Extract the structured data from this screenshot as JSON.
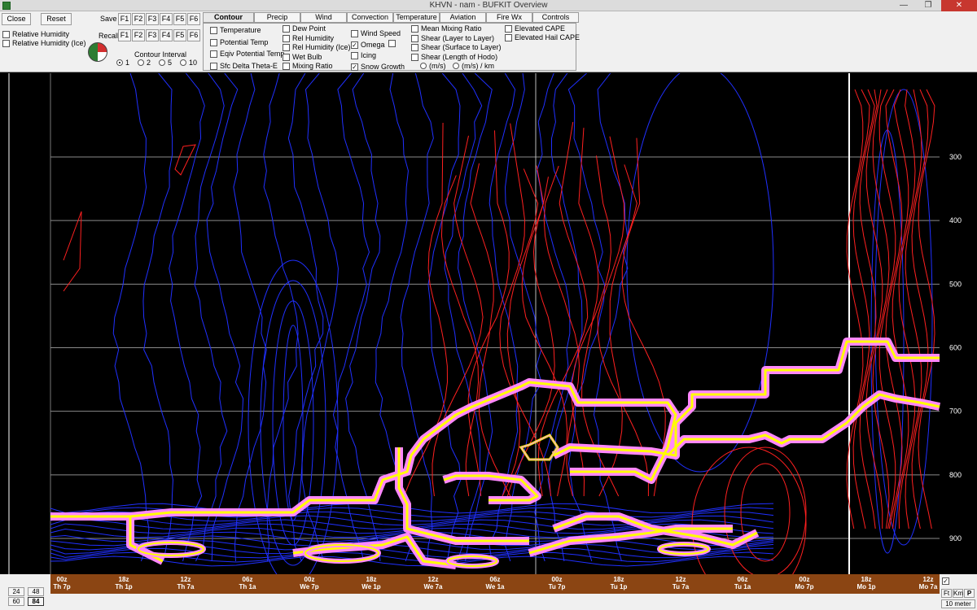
{
  "window": {
    "title": "KHVN - nam - BUFKIT Overview",
    "minimize": "—",
    "maximize": "❐",
    "close": "✕"
  },
  "toolbar": {
    "close_label": "Close",
    "reset_label": "Reset",
    "save_label": "Save",
    "recall_label": "Recall",
    "fkeys": [
      "F1",
      "F2",
      "F3",
      "F4",
      "F5",
      "F6"
    ],
    "left_checks": [
      "Relative Humidity",
      "Relative Humidity (Ice)"
    ],
    "contour_interval_label": "Contour Interval",
    "contour_intervals": [
      "1",
      "2",
      "5",
      "10"
    ],
    "contour_interval_selected": "1"
  },
  "tabs": [
    "Contour",
    "Precip",
    "Wind",
    "Convection",
    "Temperature",
    "Aviation",
    "Fire Wx",
    "Controls"
  ],
  "active_tab": "Contour",
  "contour_options": {
    "col1": [
      {
        "label": "Temperature",
        "checked": false
      },
      {
        "label": "Potential Temp",
        "checked": false
      },
      {
        "label": "Eqiv Potential Temp",
        "checked": false
      },
      {
        "label": "Sfc Delta Theta-E",
        "checked": false
      }
    ],
    "col2": [
      {
        "label": "Dew Point",
        "checked": false
      },
      {
        "label": "Rel Humidity",
        "checked": false
      },
      {
        "label": "Rel Humidity (Ice)",
        "checked": false
      },
      {
        "label": "Wet Bulb",
        "checked": false
      },
      {
        "label": "Mixing Ratio",
        "checked": false
      }
    ],
    "col3": [
      {
        "label": "Wind Speed",
        "checked": false
      },
      {
        "label": "Omega",
        "checked": true
      },
      {
        "label": "Icing",
        "checked": false
      },
      {
        "label": "Snow Growth",
        "checked": true
      }
    ],
    "col4": [
      {
        "label": "Mean Mixing Ratio",
        "checked": false
      },
      {
        "label": "Shear (Layer to Layer)",
        "checked": false
      },
      {
        "label": "Shear (Surface to Layer)",
        "checked": false
      },
      {
        "label": "Shear (Length of Hodo)",
        "checked": false
      }
    ],
    "shear_units": [
      "(m/s)",
      "(m/s) / km"
    ],
    "col5": [
      {
        "label": "Elevated CAPE",
        "checked": false
      },
      {
        "label": "Elevated Hail CAPE",
        "checked": false
      }
    ]
  },
  "pressure_levels": [
    "300",
    "400",
    "500",
    "600",
    "700",
    "800",
    "900"
  ],
  "time_labels": [
    {
      "top": "00z",
      "bottom": "Th 7p"
    },
    {
      "top": "18z",
      "bottom": "Th 1p"
    },
    {
      "top": "12z",
      "bottom": "Th 7a"
    },
    {
      "top": "06z",
      "bottom": "Th 1a"
    },
    {
      "top": "00z",
      "bottom": "We 7p"
    },
    {
      "top": "18z",
      "bottom": "We 1p"
    },
    {
      "top": "12z",
      "bottom": "We 7a"
    },
    {
      "top": "06z",
      "bottom": "We 1a"
    },
    {
      "top": "00z",
      "bottom": "Tu 7p"
    },
    {
      "top": "18z",
      "bottom": "Tu 1p"
    },
    {
      "top": "12z",
      "bottom": "Tu 7a"
    },
    {
      "top": "06z",
      "bottom": "Tu 1a"
    },
    {
      "top": "00z",
      "bottom": "Mo 7p"
    },
    {
      "top": "18z",
      "bottom": "Mo 1p"
    },
    {
      "top": "12z",
      "bottom": "Mo 7a"
    }
  ],
  "hours_buttons": [
    "24",
    "48",
    "60",
    "84"
  ],
  "hours_selected": "84",
  "units_buttons": [
    "Ft",
    "Km",
    "P"
  ],
  "units_selected": "P",
  "height_label": "10 meter",
  "colors": {
    "omega_negative": "#ff2020",
    "omega_positive": "#2030ff",
    "snow_growth_inner": "#ffff00",
    "snow_growth_outer": "#ff88ff",
    "time_axis": "#8b4513"
  }
}
